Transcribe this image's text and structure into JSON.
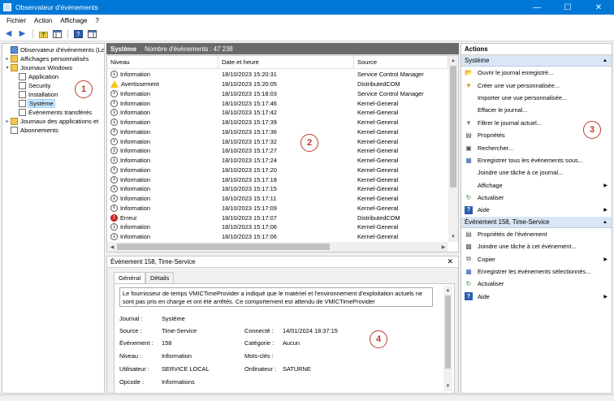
{
  "window": {
    "title": "Observateur d'événements",
    "minimize": "—",
    "maximize": "☐",
    "close": "✕"
  },
  "menu": [
    "Fichier",
    "Action",
    "Affichage",
    "?"
  ],
  "tree": {
    "root": "Observateur d'événements (Loc",
    "custom_views": "Affichages personnalisés",
    "windows_logs": "Journaux Windows",
    "logs": [
      "Application",
      "Security",
      "Installation",
      "Système",
      "Événements transférés"
    ],
    "app_services": "Journaux des applications et",
    "subscriptions": "Abonnements"
  },
  "badges": [
    "1",
    "2",
    "3",
    "4"
  ],
  "middle": {
    "log_name": "Système",
    "event_count": "Nombre d'événements : 47 238"
  },
  "columns": [
    "Niveau",
    "Date et heure",
    "Source"
  ],
  "events": [
    {
      "level": "Information",
      "type": "info",
      "date": "18/10/2023 15:20:31",
      "source": "Service Control Manager"
    },
    {
      "level": "Avertissement",
      "type": "warn",
      "date": "18/10/2023 15:20:05",
      "source": "DistributedCOM"
    },
    {
      "level": "Information",
      "type": "info",
      "date": "18/10/2023 15:18:03",
      "source": "Service Control Manager"
    },
    {
      "level": "Information",
      "type": "info",
      "date": "18/10/2023 15:17:46",
      "source": "Kernel-General"
    },
    {
      "level": "Information",
      "type": "info",
      "date": "18/10/2023 15:17:42",
      "source": "Kernel-General"
    },
    {
      "level": "Information",
      "type": "info",
      "date": "18/10/2023 15:17:39",
      "source": "Kernel-General"
    },
    {
      "level": "Information",
      "type": "info",
      "date": "18/10/2023 15:17:36",
      "source": "Kernel-General"
    },
    {
      "level": "Information",
      "type": "info",
      "date": "18/10/2023 15:17:32",
      "source": "Kernel-General"
    },
    {
      "level": "Information",
      "type": "info",
      "date": "18/10/2023 15:17:27",
      "source": "Kernel-General"
    },
    {
      "level": "Information",
      "type": "info",
      "date": "18/10/2023 15:17:24",
      "source": "Kernel-General"
    },
    {
      "level": "Information",
      "type": "info",
      "date": "18/10/2023 15:17:20",
      "source": "Kernel-General"
    },
    {
      "level": "Information",
      "type": "info",
      "date": "18/10/2023 15:17:18",
      "source": "Kernel-General"
    },
    {
      "level": "Information",
      "type": "info",
      "date": "18/10/2023 15:17:15",
      "source": "Kernel-General"
    },
    {
      "level": "Information",
      "type": "info",
      "date": "18/10/2023 15:17:11",
      "source": "Kernel-General"
    },
    {
      "level": "Information",
      "type": "info",
      "date": "18/10/2023 15:17:09",
      "source": "Kernel-General"
    },
    {
      "level": "Erreur",
      "type": "err",
      "date": "18/10/2023 15:17:07",
      "source": "DistributedCOM"
    },
    {
      "level": "Information",
      "type": "info",
      "date": "18/10/2023 15:17:06",
      "source": "Kernel-General"
    },
    {
      "level": "Information",
      "type": "info",
      "date": "18/10/2023 15:17:06",
      "source": "Kernel-General"
    }
  ],
  "detail": {
    "title": "Événement 158, Time-Service",
    "close": "✕",
    "tabs": [
      "Général",
      "Détails"
    ],
    "description": "Le fournisseur de temps VMICTimeProvider a indiqué que le matériel et l'environnement d'exploitation actuels ne sont pas pris en charge et ont été arrêtés. Ce comportement est attendu de VMICTimeProvider",
    "labels": {
      "journal": "Journal :",
      "source": "Source :",
      "event": "Événement :",
      "level": "Niveau :",
      "user": "Utilisateur :",
      "connected": "Connecté :",
      "category": "Catégorie :",
      "keywords": "Mots-clés :",
      "computer": "Ordinateur :",
      "opcode": "Opcode :"
    },
    "values": {
      "journal": "Système",
      "source": "Time-Service",
      "event": "158",
      "level": "Information",
      "user": "SERVICE LOCAL",
      "connected": "14/01/2024 18:37:15",
      "category": "Aucun",
      "keywords": "",
      "computer": "SATURNE",
      "opcode": "Informations"
    }
  },
  "actions": {
    "header": "Actions",
    "section1": "Système",
    "items1": [
      {
        "label": "Ouvrir le journal enregistré...",
        "icon": "folder-open-icon",
        "sub": false
      },
      {
        "label": "Créer une vue personnalisée...",
        "icon": "filter-create-icon",
        "sub": false
      },
      {
        "label": "Importer une vue personnalisée...",
        "icon": "",
        "sub": false
      },
      {
        "label": "Effacer le journal...",
        "icon": "",
        "sub": false
      },
      {
        "label": "Filtrer le journal actuel...",
        "icon": "filter-icon",
        "sub": false
      },
      {
        "label": "Propriétés",
        "icon": "properties-icon",
        "sub": false
      },
      {
        "label": "Rechercher...",
        "icon": "find-icon",
        "sub": false
      },
      {
        "label": "Enregistrer tous les événements sous...",
        "icon": "save-icon",
        "sub": false
      },
      {
        "label": "Joindre une tâche à ce journal...",
        "icon": "",
        "sub": false
      },
      {
        "label": "Affichage",
        "icon": "",
        "sub": true
      },
      {
        "label": "Actualiser",
        "icon": "refresh-icon",
        "sub": false
      },
      {
        "label": "Aide",
        "icon": "help-icon",
        "sub": true
      }
    ],
    "section2": "Événement 158, Time-Service",
    "items2": [
      {
        "label": "Propriétés de l'événement",
        "icon": "event-properties-icon",
        "sub": false
      },
      {
        "label": "Joindre une tâche à cet événement...",
        "icon": "task-icon",
        "sub": false
      },
      {
        "label": "Copier",
        "icon": "copy-icon",
        "sub": true
      },
      {
        "label": "Enregistrer les événements sélectionnés...",
        "icon": "save-icon",
        "sub": false
      },
      {
        "label": "Actualiser",
        "icon": "refresh-icon",
        "sub": false
      },
      {
        "label": "Aide",
        "icon": "help-icon",
        "sub": true
      }
    ]
  },
  "colors": {
    "titlebar": "#0078d7",
    "badge": "#c0392b",
    "section": "#d9e6f5",
    "selection": "#cce8ff"
  }
}
